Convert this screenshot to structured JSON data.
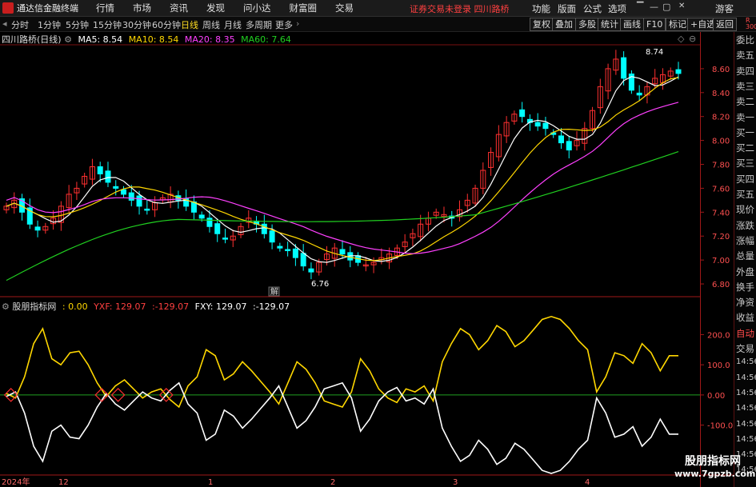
{
  "menubar": {
    "app_name": "通达信金融终端",
    "items": [
      "行情",
      "市场",
      "资讯",
      "发现",
      "问小达",
      "财富圈",
      "交易"
    ],
    "notice": "证券交易未登录  四川路桥",
    "right_items": [
      "功能",
      "版面",
      "公式",
      "选项"
    ],
    "guest": "游客"
  },
  "periodbar": {
    "periods": [
      "分时",
      "1分钟",
      "5分钟",
      "15分钟",
      "30分钟",
      "60分钟",
      "日线",
      "周线",
      "月线",
      "多周期",
      "更多"
    ],
    "active": "日线",
    "tools": [
      "复权",
      "叠加",
      "多股",
      "统计",
      "画线",
      "F10",
      "标记",
      "+自选",
      "返回"
    ]
  },
  "stock": {
    "title": "四川路桥(日线)",
    "ma": [
      {
        "label": "MA5: 8.54",
        "color": "#ffffff"
      },
      {
        "label": "MA10: 8.54",
        "color": "#ffd700"
      },
      {
        "label": "MA20: 8.35",
        "color": "#ff40ff"
      },
      {
        "label": "MA60: 7.64",
        "color": "#20d020"
      }
    ]
  },
  "indicator": {
    "name": "股朋指标网",
    "values": [
      {
        "label": ": 0.00",
        "color": "#ffd700"
      },
      {
        "label": "YXF: 129.07",
        "color": "#ff4040"
      },
      {
        "label": ":-129.07",
        "color": "#ff4040"
      },
      {
        "label": "FXY: 129.07",
        "color": "#ffffff"
      },
      {
        "label": ":-129.07",
        "color": "#ffffff"
      }
    ]
  },
  "price_axis": {
    "ticks": [
      "8.60",
      "8.40",
      "8.20",
      "8.00",
      "7.80",
      "7.60",
      "7.40",
      "7.20",
      "7.00",
      "6.80"
    ]
  },
  "ind_axis": {
    "ticks": [
      "200.0",
      "100.0",
      "0.00",
      "-100.0"
    ]
  },
  "annotations": {
    "high": "8.74",
    "low": "6.76",
    "jie": "解"
  },
  "date_axis": {
    "labels": [
      "2024年",
      "12",
      "1",
      "2",
      "3",
      "4"
    ]
  },
  "sidebar": {
    "items": [
      "委比",
      "卖五",
      "卖四",
      "卖三",
      "卖二",
      "卖一",
      "买一",
      "买二",
      "买三",
      "买四",
      "买五",
      "现价",
      "涨跌",
      "涨幅",
      "总量",
      "外盘",
      "换手",
      "净资",
      "收益",
      "自动",
      "交易",
      "14:56",
      "14:56",
      "14:56",
      "14:56",
      "14:56",
      "14:56",
      "14:56",
      "14:56"
    ],
    "corner": "R 300"
  },
  "watermark": {
    "line1": "股朋指标网",
    "line2": "www.7gpzb.com"
  },
  "colors": {
    "up": "#ff3030",
    "down": "#00ffff",
    "ma5": "#ffffff",
    "ma10": "#ffd700",
    "ma20": "#ff40ff",
    "ma60": "#20d020"
  },
  "chart_data": {
    "type": "candlestick",
    "price_ylim": [
      6.7,
      8.8
    ],
    "closes": [
      7.45,
      7.5,
      7.4,
      7.3,
      7.25,
      7.28,
      7.35,
      7.45,
      7.55,
      7.6,
      7.7,
      7.78,
      7.72,
      7.65,
      7.6,
      7.55,
      7.5,
      7.45,
      7.42,
      7.48,
      7.52,
      7.55,
      7.5,
      7.45,
      7.4,
      7.35,
      7.28,
      7.22,
      7.18,
      7.2,
      7.28,
      7.35,
      7.3,
      7.22,
      7.15,
      7.1,
      7.08,
      7.02,
      6.95,
      6.9,
      6.98,
      7.05,
      7.1,
      7.05,
      7.0,
      6.98,
      6.96,
      6.98,
      7.02,
      7.05,
      7.1,
      7.15,
      7.22,
      7.3,
      7.35,
      7.4,
      7.38,
      7.35,
      7.42,
      7.5,
      7.6,
      7.75,
      7.9,
      8.05,
      8.15,
      8.22,
      8.2,
      8.15,
      8.12,
      8.1,
      8.05,
      7.98,
      7.92,
      8.0,
      8.1,
      8.25,
      8.45,
      8.6,
      8.68,
      8.52,
      8.42,
      8.38,
      8.45,
      8.52,
      8.55,
      8.58,
      8.56
    ],
    "ma5_last": 8.54,
    "ma10_last": 8.54,
    "ma20_last": 8.35,
    "ma60_last": 7.64,
    "indicator": {
      "ylim": [
        -260,
        270
      ],
      "yellow": [
        5,
        -10,
        60,
        170,
        220,
        120,
        100,
        140,
        145,
        100,
        40,
        -5,
        30,
        50,
        20,
        -10,
        10,
        20,
        -15,
        -40,
        30,
        60,
        150,
        130,
        50,
        70,
        110,
        80,
        45,
        10,
        -30,
        40,
        110,
        85,
        40,
        -20,
        -30,
        -40,
        10,
        120,
        80,
        20,
        -10,
        -25,
        20,
        10,
        30,
        -20,
        110,
        170,
        220,
        200,
        150,
        180,
        230,
        210,
        160,
        180,
        215,
        250,
        260,
        250,
        220,
        180,
        150,
        10,
        60,
        140,
        130,
        105,
        170,
        140,
        80,
        130,
        130
      ],
      "white_mirror": true
    }
  }
}
